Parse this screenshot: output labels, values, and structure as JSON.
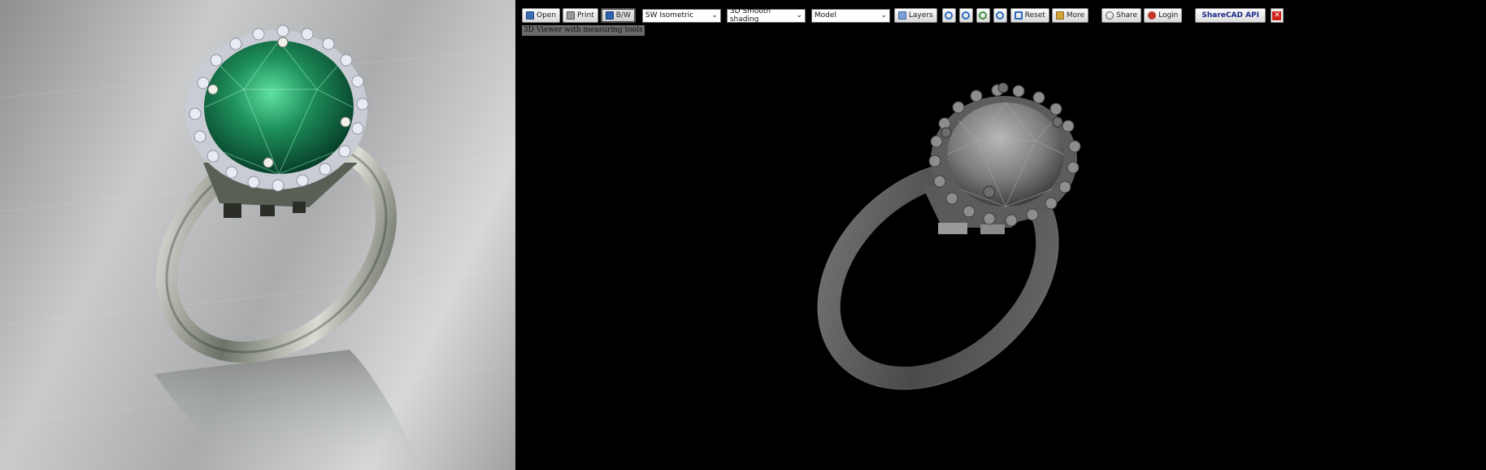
{
  "viewer": {
    "toolbar": {
      "open_label": "Open",
      "print_label": "Print",
      "bw_label": "B/W",
      "view_select": "SW Isometric",
      "shading_select": "3D Smooth shading",
      "space_select": "Model",
      "layers_label": "Layers",
      "reset_label": "Reset",
      "more_label": "More",
      "share_label": "Share",
      "login_label": "Login",
      "api_label": "ShareCAD API"
    },
    "caption": "3D Viewer with measuring tools"
  },
  "colors": {
    "gem_green": "#1e8f5a",
    "model_gray": "#5a5a5a",
    "close_red": "#d0201a",
    "api_blue": "#1b2a8a"
  },
  "icons": [
    "open-icon",
    "print-icon",
    "bw-icon",
    "layers-icon",
    "zoom-in-icon",
    "zoom-out-icon",
    "zoom-extents-icon",
    "zoom-window-icon",
    "reset-icon",
    "more-icon",
    "share-icon",
    "login-icon",
    "close-icon"
  ]
}
